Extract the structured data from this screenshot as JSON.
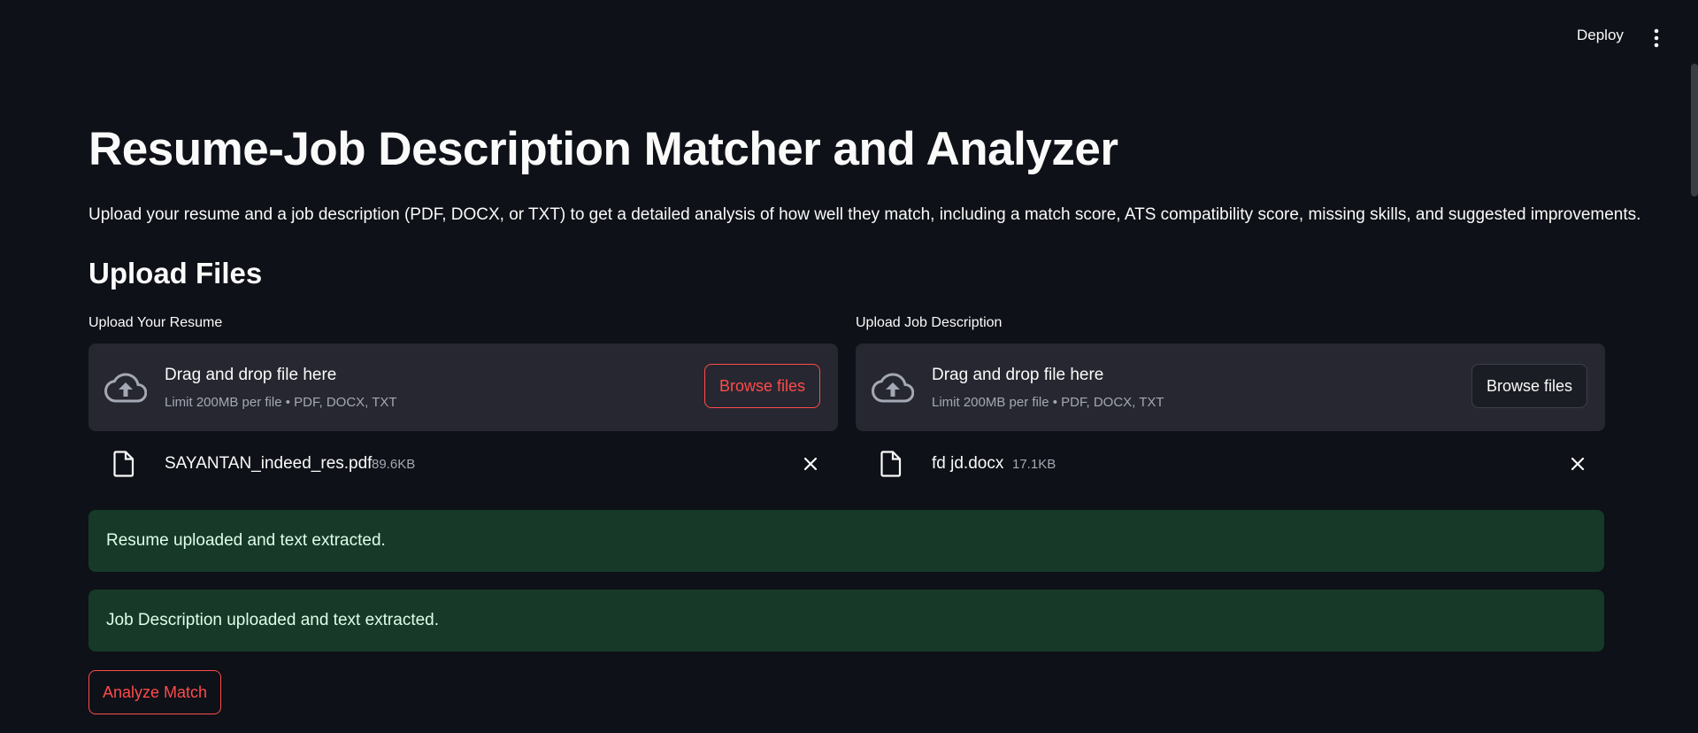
{
  "header": {
    "deploy_label": "Deploy",
    "menu_icon": "vertical-ellipsis-icon"
  },
  "main": {
    "title": "Resume-Job Description Matcher and Analyzer",
    "description": "Upload your resume and a job description (PDF, DOCX, or TXT) to get a detailed analysis of how well they match, including a match score, ATS compatibility score, missing skills, and suggested improvements.",
    "section_title": "Upload Files"
  },
  "uploaders": [
    {
      "label": "Upload Your Resume",
      "drop_title": "Drag and drop file here",
      "drop_sub": "Limit 200MB per file • PDF, DOCX, TXT",
      "browse_label": "Browse files",
      "file_name": "SAYANTAN_indeed_res.pdf",
      "file_size": "89.6KB"
    },
    {
      "label": "Upload Job Description",
      "drop_title": "Drag and drop file here",
      "drop_sub": "Limit 200MB per file • PDF, DOCX, TXT",
      "browse_label": "Browse files",
      "file_name": "fd jd.docx",
      "file_size": "17.1KB"
    }
  ],
  "alerts": [
    "Resume uploaded and text extracted.",
    "Job Description uploaded and text extracted."
  ],
  "analyze_label": "Analyze Match",
  "colors": {
    "background": "#0e1117",
    "surface": "#262730",
    "accent": "#ff4b4b",
    "success_bg": "#173928"
  }
}
